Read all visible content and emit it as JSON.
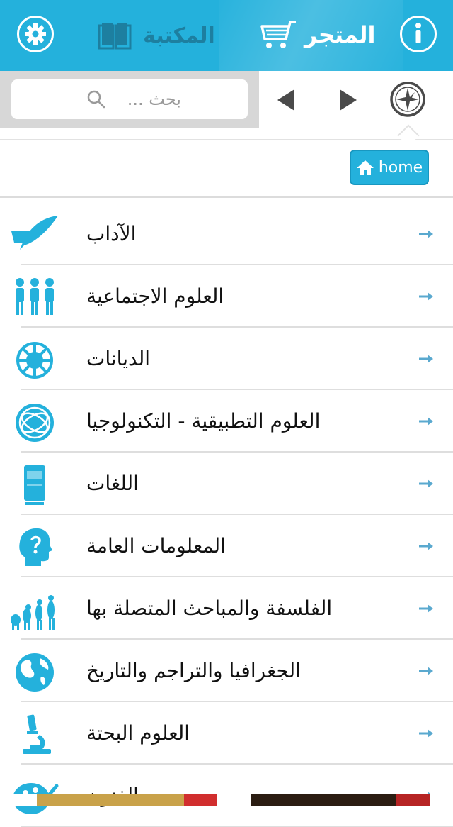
{
  "header": {
    "library_label": "المكتبة",
    "store_label": "المتجر",
    "settings_icon": "gear-icon",
    "info_icon": "info-icon",
    "bar_color": "#24b1dc"
  },
  "nav": {
    "search_placeholder": "بحث ...",
    "back_icon": "triangle-left-icon",
    "forward_icon": "triangle-right-icon",
    "compass_icon": "compass-icon"
  },
  "breadcrumb": {
    "home_label": "home"
  },
  "categories": [
    {
      "label": "الآداب",
      "icon": "quill-icon"
    },
    {
      "label": "العلوم الاجتماعية",
      "icon": "people-icon"
    },
    {
      "label": "الديانات",
      "icon": "islamic-pattern-icon"
    },
    {
      "label": "العلوم التطبيقية - التكنولوجيا",
      "icon": "globe-network-icon"
    },
    {
      "label": "اللغات",
      "icon": "dictionary-icon"
    },
    {
      "label": "المعلومات العامة",
      "icon": "head-question-icon"
    },
    {
      "label": "الفلسفة والمباحث المتصلة بها",
      "icon": "evolution-icon"
    },
    {
      "label": "الجغرافيا والتراجم والتاريخ",
      "icon": "globe-icon"
    },
    {
      "label": "العلوم البحتة",
      "icon": "microscope-icon"
    },
    {
      "label": "الفنون",
      "icon": "palette-icon"
    }
  ],
  "accent_color": "#24b1dc",
  "arrow_color": "#5aa9cf"
}
